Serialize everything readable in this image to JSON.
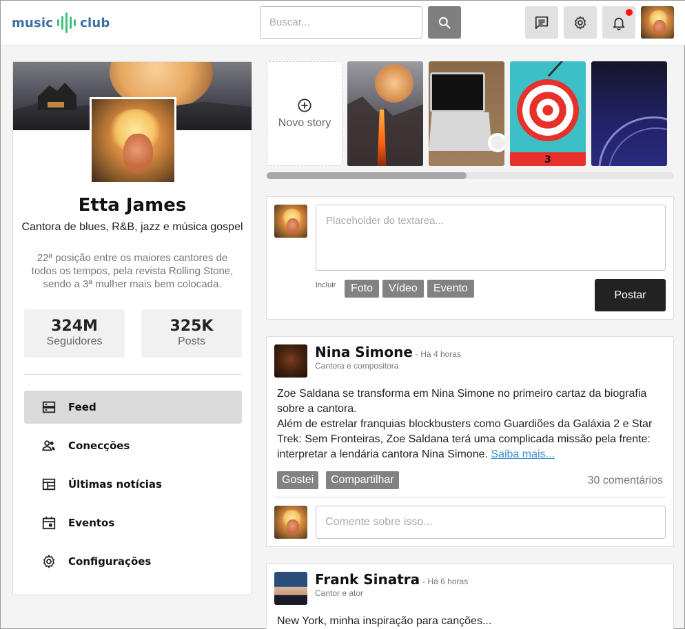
{
  "app": {
    "logo_left": "music",
    "logo_right": "club"
  },
  "header": {
    "search_placeholder": "Buscar...",
    "icons": [
      "search-icon",
      "chat-icon",
      "gear-icon",
      "bell-icon"
    ],
    "notification_dot_color": "#ff1111"
  },
  "profile": {
    "name": "Etta James",
    "role": "Cantora de blues, R&B, jazz e música gospel",
    "bio": "22ª posição entre os maiores cantores de todos os tempos, pela revista Rolling Stone, sendo a 3ª mulher mais bem colocada.",
    "stats": [
      {
        "value": "324M",
        "label": "Seguidores"
      },
      {
        "value": "325K",
        "label": "Posts"
      }
    ]
  },
  "nav": {
    "items": [
      {
        "label": "Feed",
        "icon": "feed-icon",
        "active": true
      },
      {
        "label": "Conecções",
        "icon": "people-icon",
        "active": false
      },
      {
        "label": "Últimas notícias",
        "icon": "news-icon",
        "active": false
      },
      {
        "label": "Eventos",
        "icon": "calendar-icon",
        "active": false
      },
      {
        "label": "Configurações",
        "icon": "gear-icon",
        "active": false
      }
    ]
  },
  "stories": {
    "new_label": "Novo story",
    "badge": "3",
    "scroll_position": 0.49
  },
  "composer": {
    "placeholder": "Placeholder do textarea...",
    "include_label": "Incluir",
    "chips": [
      "Foto",
      "Vídeo",
      "Evento"
    ],
    "submit": "Postar"
  },
  "posts": [
    {
      "author": "Nina Simone",
      "time": "- Há 4 horas",
      "subtitle": "Cantora e compositora",
      "body_1": "Zoe Saldana se transforma em Nina Simone no primeiro cartaz da biografia sobre a cantora.",
      "body_2": "Além de estrelar franquias blockbusters como Guardiões da Galáxia 2 e Star Trek: Sem Fronteiras, Zoe Saldana terá uma complicada missão pela frente: interpretar a lendária cantora Nina Simone.",
      "link": "Saiba mais...",
      "like": "Gostei",
      "share": "Compartilhar",
      "comments": "30 comentários",
      "comment_placeholder": "Comente sobre isso..."
    },
    {
      "author": "Frank Sinatra",
      "time": "- Há 6 horas",
      "subtitle": "Cantor e ator",
      "body_1": "New York, minha inspiração para canções..."
    }
  ],
  "colors": {
    "brand_blue": "#3a6ea5",
    "brand_green": "#3cc27a",
    "chip_gray": "#828282",
    "button_dark": "#222222",
    "link": "#3a8fd0"
  }
}
